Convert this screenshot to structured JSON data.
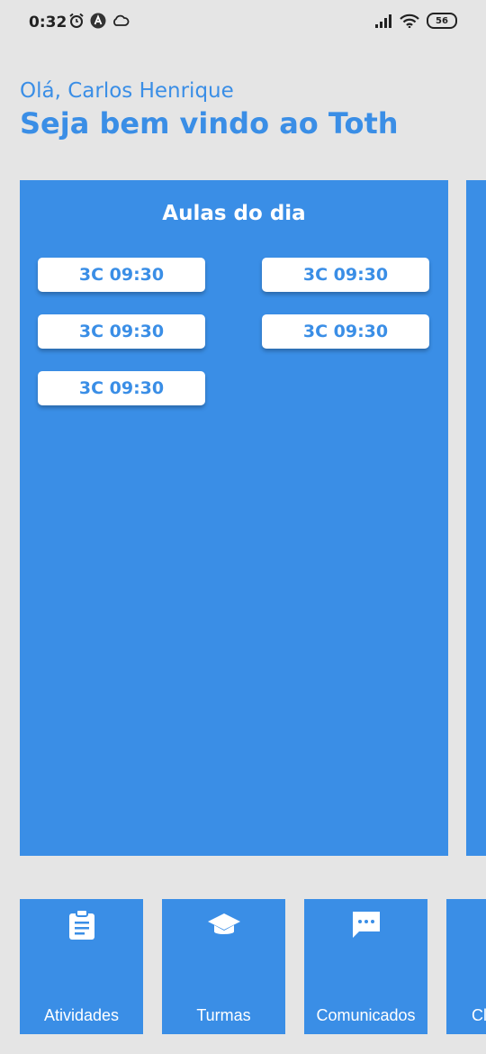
{
  "status": {
    "time": "0:32",
    "battery": "56"
  },
  "header": {
    "greeting": "Olá, Carlos Henrique",
    "welcome": "Seja bem vindo ao Toth"
  },
  "classes_card": {
    "title": "Aulas do dia",
    "items": [
      "3C 09:30",
      "3C 09:30",
      "3C 09:30",
      "3C 09:30",
      "3C 09:30"
    ]
  },
  "nav": {
    "tiles": [
      {
        "label": "Atividades",
        "icon": "clipboard-icon"
      },
      {
        "label": "Turmas",
        "icon": "graduation-cap-icon"
      },
      {
        "label": "Comunicados",
        "icon": "message-icon"
      },
      {
        "label": "Cl",
        "icon": ""
      }
    ]
  },
  "colors": {
    "accent": "#3a8ee6",
    "background": "#e5e5e5"
  }
}
